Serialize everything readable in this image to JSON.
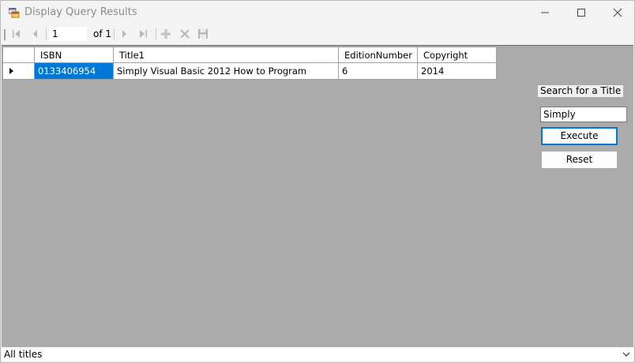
{
  "window": {
    "title": "Display Query Results",
    "controls": [
      "minimize-icon",
      "maximize-icon",
      "close-icon"
    ]
  },
  "navigator": {
    "position": "1",
    "count_label": "of 1",
    "icons": [
      "move-first-icon",
      "move-previous-icon",
      "move-next-icon",
      "move-last-icon",
      "add-new-icon",
      "delete-icon",
      "save-icon"
    ]
  },
  "grid": {
    "columns": [
      "ISBN",
      "Title1",
      "EditionNumber",
      "Copyright"
    ],
    "rows": [
      {
        "isbn": "0133406954",
        "title": "Simply Visual Basic 2012 How to Program",
        "edition": "6",
        "copyright": "2014"
      }
    ],
    "colors": {
      "selection": "#0078d7",
      "background": "#ababab"
    }
  },
  "search": {
    "label": "Search for a Title",
    "value": "Simply",
    "execute_label": "Execute",
    "reset_label": "Reset"
  },
  "query_select": {
    "selected": "All titles"
  }
}
